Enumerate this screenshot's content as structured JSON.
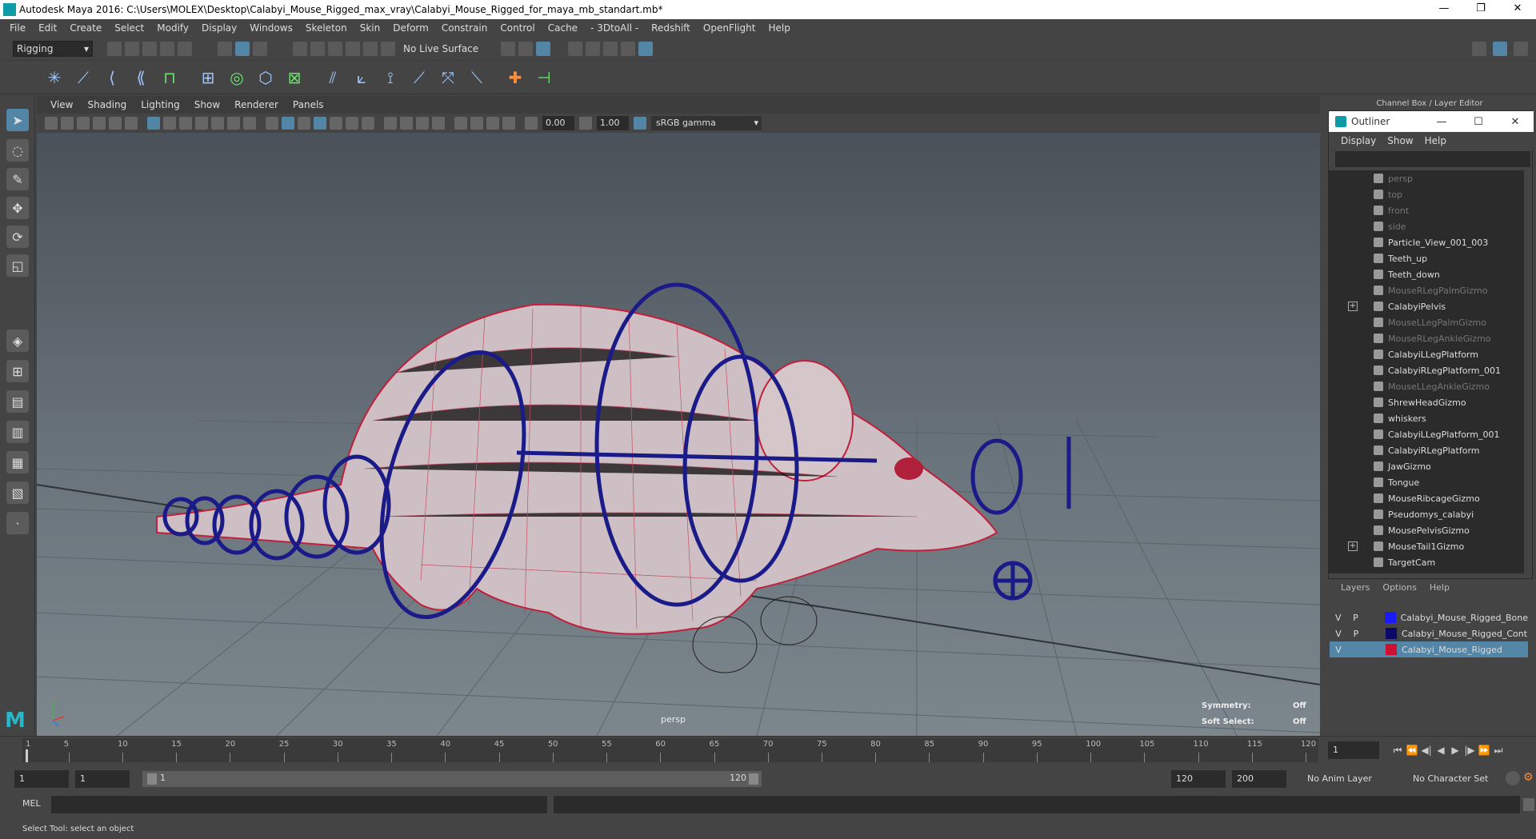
{
  "window": {
    "title": "Autodesk Maya 2016: C:\\Users\\MOLEX\\Desktop\\Calabyi_Mouse_Rigged_max_vray\\Calabyi_Mouse_Rigged_for_maya_mb_standart.mb*",
    "minimize": "—",
    "restore": "❐",
    "close": "✕"
  },
  "menubar": [
    "File",
    "Edit",
    "Create",
    "Select",
    "Modify",
    "Display",
    "Windows",
    "Skeleton",
    "Skin",
    "Deform",
    "Constrain",
    "Control",
    "Cache",
    "- 3DtoAll -",
    "Redshift",
    "OpenFlight",
    "Help"
  ],
  "statusline": {
    "mode": "Rigging",
    "live_surface": "No Live Surface"
  },
  "panel": {
    "menus": [
      "View",
      "Shading",
      "Lighting",
      "Show",
      "Renderer",
      "Panels"
    ],
    "exposure": "0.00",
    "gamma": "1.00",
    "color_space": "sRGB gamma"
  },
  "viewport": {
    "camera": "persp",
    "symmetry_label": "Symmetry:",
    "symmetry_value": "Off",
    "soft_select_label": "Soft Select:",
    "soft_select_value": "Off"
  },
  "channel_box_title": "Channel Box / Layer Editor",
  "outliner": {
    "title": "Outliner",
    "menus": [
      "Display",
      "Show",
      "Help"
    ],
    "items": [
      {
        "label": "persp",
        "dim": true,
        "expand": false
      },
      {
        "label": "top",
        "dim": true,
        "expand": false
      },
      {
        "label": "front",
        "dim": true,
        "expand": false
      },
      {
        "label": "side",
        "dim": true,
        "expand": false
      },
      {
        "label": "Particle_View_001_003",
        "dim": false,
        "expand": false
      },
      {
        "label": "Teeth_up",
        "dim": false,
        "expand": false
      },
      {
        "label": "Teeth_down",
        "dim": false,
        "expand": false
      },
      {
        "label": "MouseRLegPalmGizmo",
        "dim": true,
        "expand": false
      },
      {
        "label": "CalabyiPelvis",
        "dim": false,
        "expand": true
      },
      {
        "label": "MouseLLegPalmGizmo",
        "dim": true,
        "expand": false
      },
      {
        "label": "MouseRLegAnkleGizmo",
        "dim": true,
        "expand": false
      },
      {
        "label": "CalabyiLLegPlatform",
        "dim": false,
        "expand": false
      },
      {
        "label": "CalabyiRLegPlatform_001",
        "dim": false,
        "expand": false
      },
      {
        "label": "MouseLLegAnkleGizmo",
        "dim": true,
        "expand": false
      },
      {
        "label": "ShrewHeadGizmo",
        "dim": false,
        "expand": false
      },
      {
        "label": "whiskers",
        "dim": false,
        "expand": false
      },
      {
        "label": "CalabyiLLegPlatform_001",
        "dim": false,
        "expand": false
      },
      {
        "label": "CalabyiRLegPlatform",
        "dim": false,
        "expand": false
      },
      {
        "label": "JawGizmo",
        "dim": false,
        "expand": false
      },
      {
        "label": "Tongue",
        "dim": false,
        "expand": false
      },
      {
        "label": "MouseRibcageGizmo",
        "dim": false,
        "expand": false
      },
      {
        "label": "Pseudomys_calabyi",
        "dim": false,
        "expand": false
      },
      {
        "label": "MousePelvisGizmo",
        "dim": false,
        "expand": false
      },
      {
        "label": "MouseTail1Gizmo",
        "dim": false,
        "expand": true
      },
      {
        "label": "TargetCam",
        "dim": false,
        "expand": false
      }
    ]
  },
  "layers": {
    "menus": [
      "Layers",
      "Options",
      "Help"
    ],
    "rows": [
      {
        "v": "V",
        "p": "P",
        "name": "Calabyi_Mouse_Rigged_Bone",
        "color": "#1a1aff",
        "selected": false
      },
      {
        "v": "V",
        "p": "P",
        "name": "Calabyi_Mouse_Rigged_Cont",
        "color": "#0a0a66",
        "selected": false
      },
      {
        "v": "V",
        "p": "",
        "name": "Calabyi_Mouse_Rigged",
        "color": "#cc1133",
        "selected": true
      }
    ]
  },
  "timeslider": {
    "ticks": [
      "5",
      "10",
      "15",
      "20",
      "25",
      "30",
      "35",
      "40",
      "45",
      "50",
      "55",
      "60",
      "65",
      "70",
      "75",
      "80",
      "85",
      "90",
      "95",
      "100",
      "105",
      "110",
      "115",
      "120"
    ],
    "first_tick": "1",
    "current_frame": "1"
  },
  "rangeslider": {
    "start": "1",
    "playback_start": "1",
    "range_start_label": "1",
    "range_end_label": "120",
    "playback_end": "120",
    "end": "200",
    "anim_layer": "No Anim Layer",
    "character_set": "No Character Set"
  },
  "cmdline": {
    "label": "MEL"
  },
  "helpline": "Select Tool: select an object"
}
